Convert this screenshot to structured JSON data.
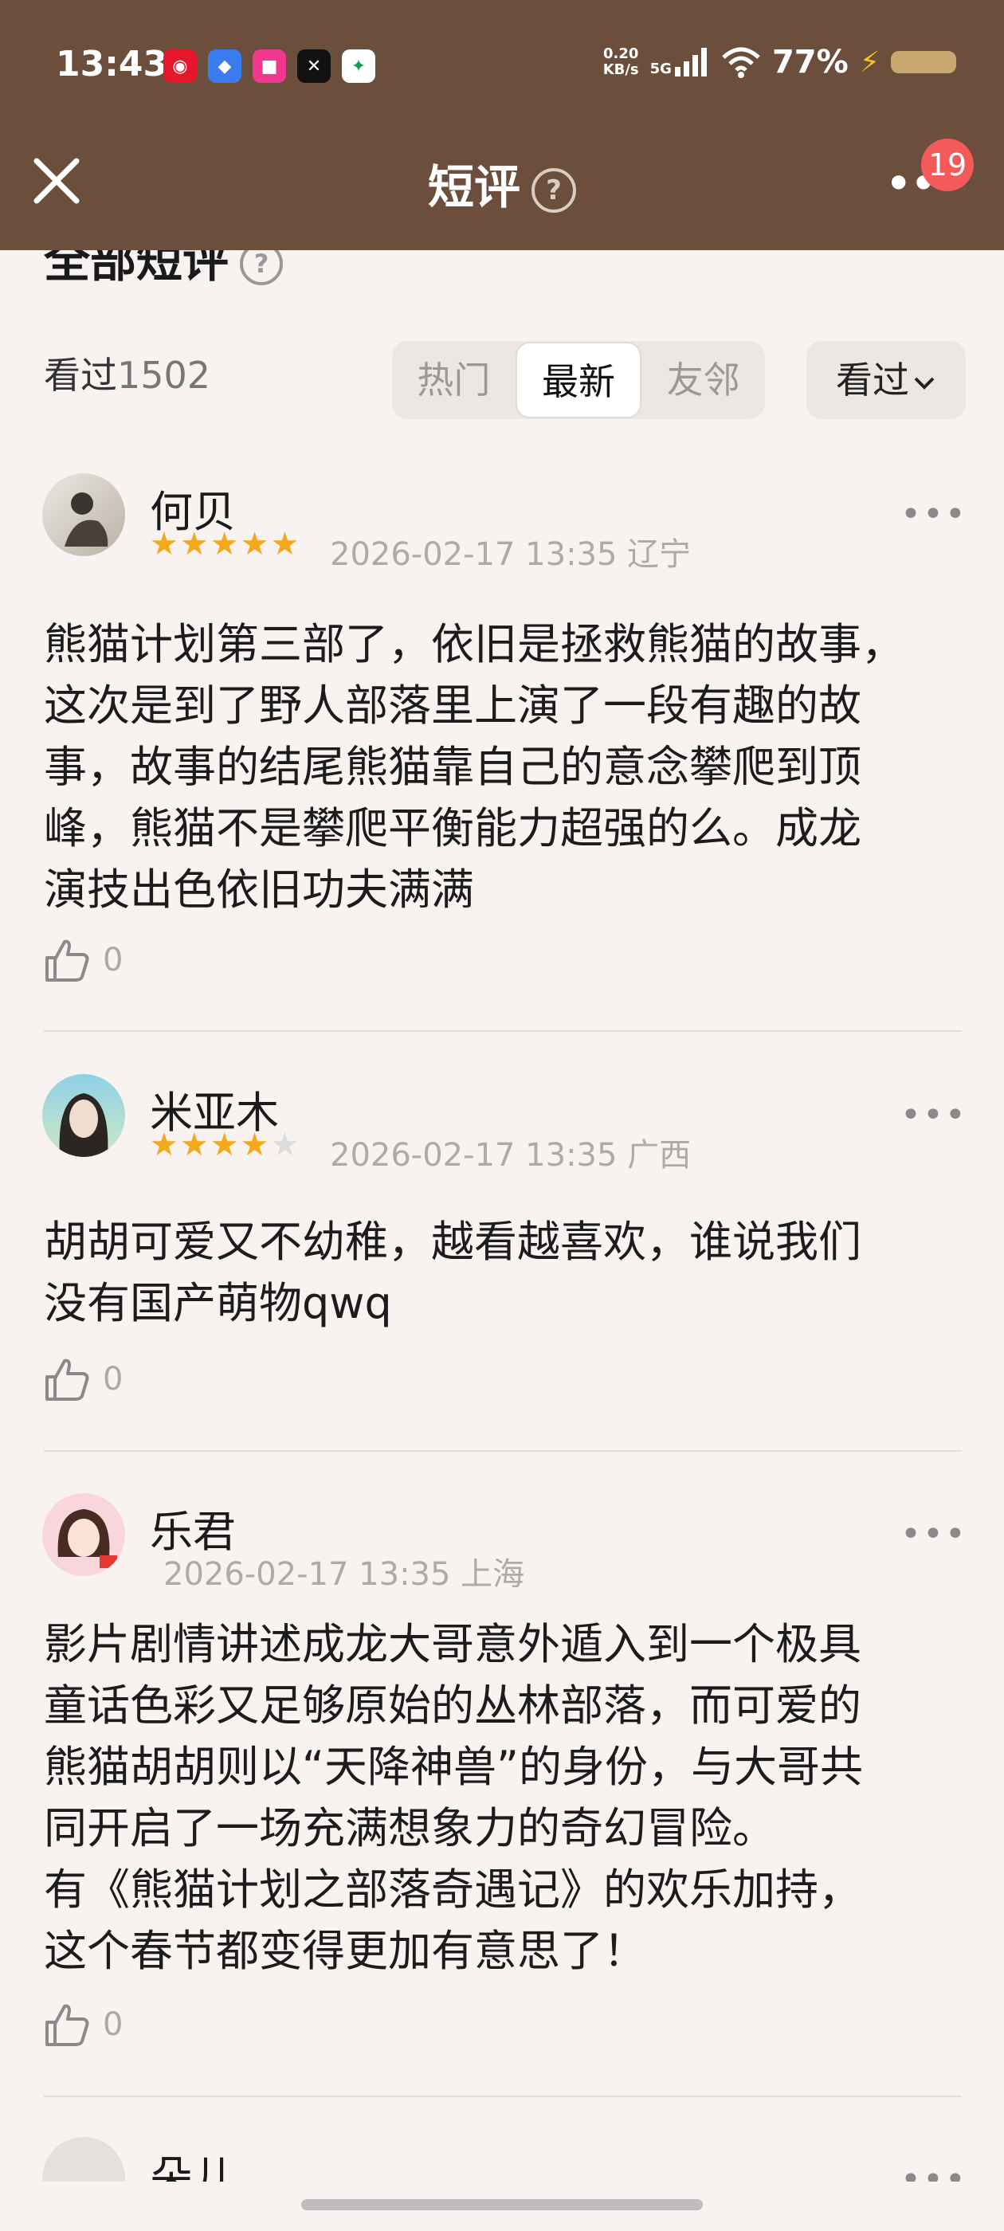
{
  "status_bar": {
    "time": "13:43",
    "net_speed_value": "0.20",
    "net_speed_unit": "KB/s",
    "network_type": "5G",
    "battery": "77%"
  },
  "header": {
    "title": "短评",
    "notification_count": "19"
  },
  "section": {
    "title": "全部短评",
    "watched_label": "看过",
    "watched_count": "1502"
  },
  "tabs": [
    {
      "label": "热门"
    },
    {
      "label": "最新",
      "active": true
    },
    {
      "label": "友邻"
    }
  ],
  "filter": {
    "label": "看过"
  },
  "reviews": [
    {
      "name": "何贝",
      "rating": 5,
      "date": "2026-02-17 13:35",
      "location": "辽宁",
      "text": "熊猫计划第三部了，依旧是拯救熊猫的故事，\n这次是到了野人部落里上演了一段有趣的故\n事，故事的结尾熊猫靠自己的意念攀爬到顶\n峰，熊猫不是攀爬平衡能力超强的么。成龙\n演技出色依旧功夫满满",
      "likes": "0"
    },
    {
      "name": "米亚木",
      "rating": 4,
      "date": "2026-02-17 13:35",
      "location": "广西",
      "text": "胡胡可爱又不幼稚，越看越喜欢，谁说我们\n没有国产萌物qwq",
      "likes": "0"
    },
    {
      "name": "乐君",
      "rating": 0,
      "date": "2026-02-17 13:35",
      "location": "上海",
      "text": "影片剧情讲述成龙大哥意外遁入到一个极具\n童话色彩又足够原始的丛林部落，而可爱的\n熊猫胡胡则以“天降神兽”的身份，与大哥共\n同开启了一场充满想象力的奇幻冒险。\n有《熊猫计划之部落奇遇记》的欢乐加持，\n这个春节都变得更加有意思了！",
      "likes": "0"
    },
    {
      "name": "朵儿"
    }
  ],
  "colors": {
    "header_bg": "#6b4f3c",
    "page_bg": "#f8f3f1",
    "star": "#f4a81c",
    "badge": "#f45a5a"
  }
}
